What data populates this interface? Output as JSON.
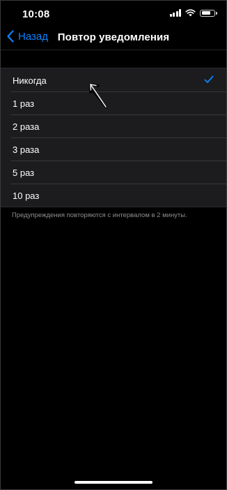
{
  "status_bar": {
    "time": "10:08",
    "icons": [
      "signal-icon",
      "wifi-icon",
      "battery-icon"
    ],
    "battery_level": 0.8
  },
  "nav": {
    "back_label": "Назад",
    "title": "Повтор уведомления"
  },
  "options": [
    {
      "label": "Никогда",
      "selected": true
    },
    {
      "label": "1 раз",
      "selected": false
    },
    {
      "label": "2 раза",
      "selected": false
    },
    {
      "label": "3 раза",
      "selected": false
    },
    {
      "label": "5 раз",
      "selected": false
    },
    {
      "label": "10 раз",
      "selected": false
    }
  ],
  "footer_note": "Предупреждения повторяются с интервалом в 2 минуты.",
  "colors": {
    "accent": "#0a84ff",
    "background": "#000000",
    "list_background": "#1c1c1e",
    "secondary_text": "#8e8e93"
  }
}
